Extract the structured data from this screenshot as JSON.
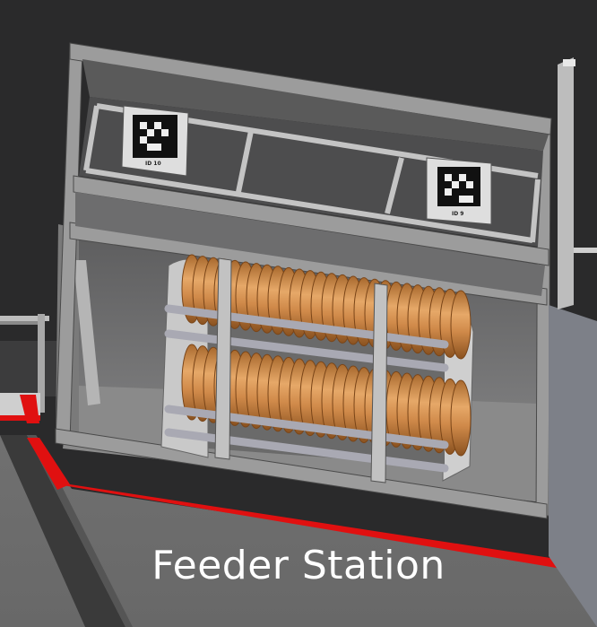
{
  "caption": "Feeder Station",
  "apriltags": [
    {
      "id_label": "ID 10"
    },
    {
      "id_label": "ID 9"
    }
  ],
  "colors": {
    "background": "#2a2a2b",
    "floor": "#6f6f6f",
    "boundary_line": "#e01010",
    "frame": "#9a9a9a",
    "cones": "#c98a4b",
    "caption_text": "#ffffff"
  }
}
